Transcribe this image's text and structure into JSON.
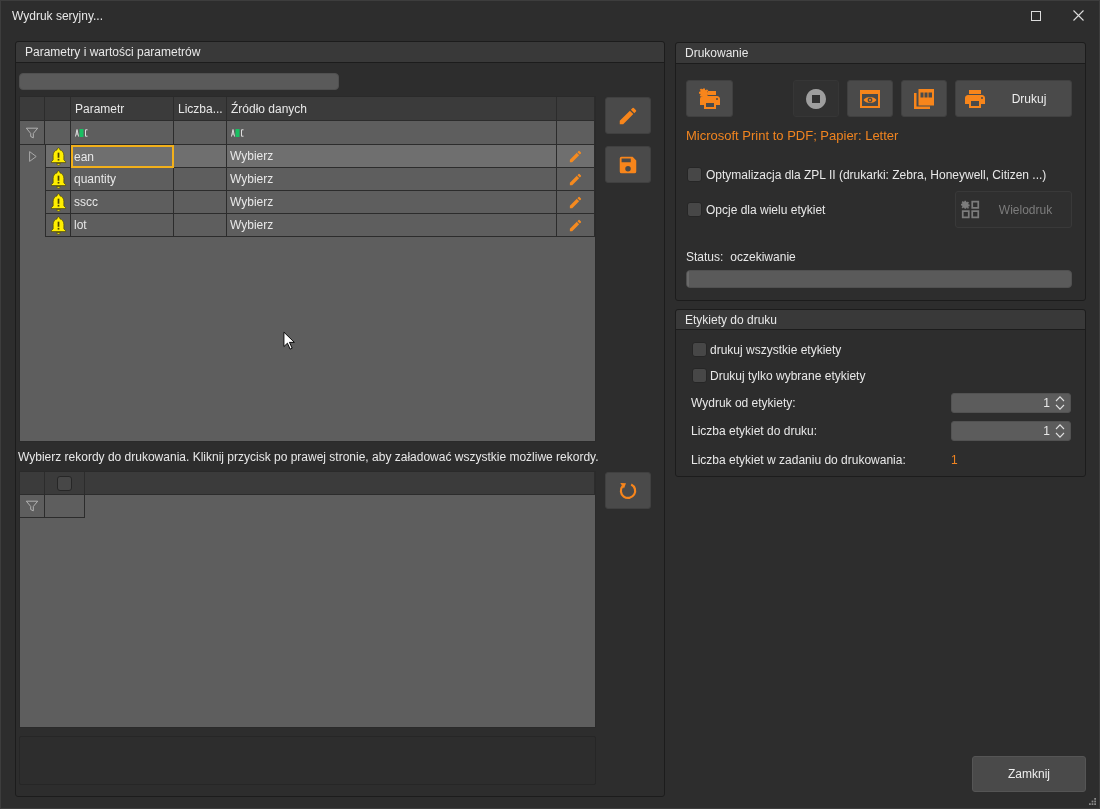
{
  "window": {
    "title": "Wydruk seryjny..."
  },
  "parameters": {
    "title": "Parametry i wartości parametrów",
    "table": {
      "columns": [
        "Parametr",
        "Liczba...",
        "Źródło danych"
      ],
      "rows": [
        {
          "name": "ean",
          "source": "Wybierz",
          "warning": true,
          "selected": true
        },
        {
          "name": "quantity",
          "source": "Wybierz",
          "warning": true,
          "selected": false
        },
        {
          "name": "sscc",
          "source": "Wybierz",
          "warning": true,
          "selected": false
        },
        {
          "name": "lot",
          "source": "Wybierz",
          "warning": true,
          "selected": false
        }
      ]
    },
    "records": {
      "instruction": "Wybierz rekordy do drukowania. Kliknij przycisk po prawej stronie, aby załadować wszystkie możliwe rekordy.",
      "select_all": {
        "checked": false
      }
    }
  },
  "printing": {
    "title": "Drukowanie",
    "toolbar": [
      {
        "kind": "printer-settings",
        "disabled": false
      },
      {
        "kind": "stop",
        "disabled": true
      },
      {
        "kind": "preview",
        "disabled": false
      },
      {
        "kind": "pdf",
        "disabled": false
      },
      {
        "kind": "print",
        "label": "Drukuj",
        "disabled": false
      }
    ],
    "printer_info": "Microsoft Print to PDF; Papier: Letter",
    "options": [
      {
        "label": "Optymalizacja dla ZPL II (drukarki: Zebra, Honeywell, Citizen ...)",
        "checked": false
      },
      {
        "label": "Opcje dla wielu etykiet",
        "checked": false
      }
    ],
    "multiprint_button": {
      "label": "Wielodruk",
      "disabled": true
    },
    "status": {
      "label": "Status:",
      "value": "oczekiwanie"
    },
    "progress": {
      "level": 0
    }
  },
  "labels": {
    "title": "Etykiety do druku",
    "options": [
      {
        "label": "drukuj wszystkie etykiety",
        "checked": false
      },
      {
        "label": "Drukuj tylko wybrane etykiety",
        "checked": false
      }
    ],
    "fields": [
      {
        "label": "Wydruk od etykiety:",
        "value": "1"
      },
      {
        "label": "Liczba etykiet do druku:",
        "value": "1"
      }
    ],
    "total": {
      "label": "Liczba etykiet w zadaniu do drukowania:",
      "value": "1"
    }
  },
  "close_button": {
    "label": "Zamknij"
  }
}
